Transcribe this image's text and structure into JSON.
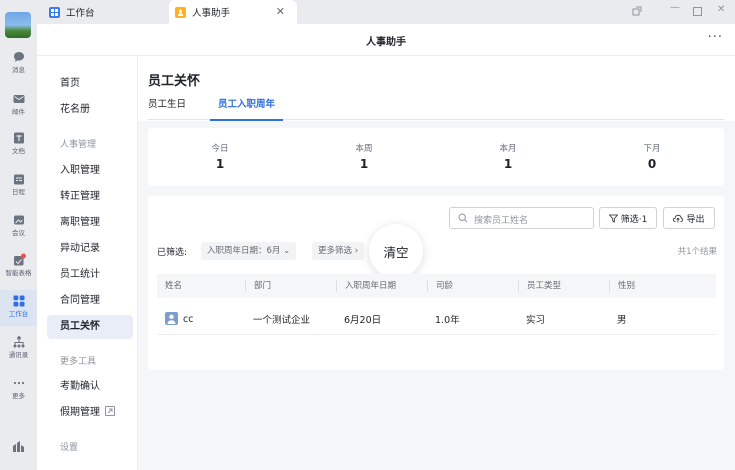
{
  "rail": {
    "items": [
      {
        "label": "消息",
        "icon": "message-icon"
      },
      {
        "label": "邮件",
        "icon": "mail-icon"
      },
      {
        "label": "文档",
        "icon": "doc-icon"
      },
      {
        "label": "日程",
        "icon": "calendar-icon"
      },
      {
        "label": "会议",
        "icon": "meeting-icon"
      },
      {
        "label": "智能表格",
        "icon": "smart-sheet-icon"
      },
      {
        "label": "工作台",
        "icon": "workbench-icon"
      },
      {
        "label": "通讯录",
        "icon": "contacts-icon"
      },
      {
        "label": "更多",
        "icon": "more-icon"
      }
    ]
  },
  "tabs": {
    "workbench": "工作台",
    "hr_assistant": "人事助手"
  },
  "app": {
    "title": "人事助手"
  },
  "sidebar": {
    "home": "首页",
    "roster": "花名册",
    "hr_section": "人事管理",
    "onboarding": "入职管理",
    "regularization": "转正管理",
    "offboarding": "离职管理",
    "changes": "异动记录",
    "stats": "员工统计",
    "contracts": "合同管理",
    "care": "员工关怀",
    "tools_section": "更多工具",
    "attendance": "考勤确认",
    "leave": "假期管理",
    "settings_section": "设置"
  },
  "page": {
    "title": "员工关怀",
    "tab_birthday": "员工生日",
    "tab_anniversary": "员工入职周年"
  },
  "stats": [
    {
      "label": "今日",
      "value": "1"
    },
    {
      "label": "本周",
      "value": "1"
    },
    {
      "label": "本月",
      "value": "1"
    },
    {
      "label": "下月",
      "value": "0"
    }
  ],
  "toolbar": {
    "search_placeholder": "搜索员工姓名",
    "filter_label": "筛选·1",
    "export_label": "导出"
  },
  "filters": {
    "label": "已筛选:",
    "chip_anniversary": "入职周年日期：6月",
    "chip_more": "更多筛选",
    "clear": "清空",
    "total": "共1个结果"
  },
  "table": {
    "headers": [
      "姓名",
      "部门",
      "入职周年日期",
      "司龄",
      "员工类型",
      "性别"
    ],
    "rows": [
      {
        "name": "cc",
        "dept": "一个测试企业",
        "date": "6月20日",
        "tenure": "1.0年",
        "type": "实习",
        "gender": "男"
      }
    ]
  },
  "colors": {
    "accent": "#2f6fe0"
  }
}
